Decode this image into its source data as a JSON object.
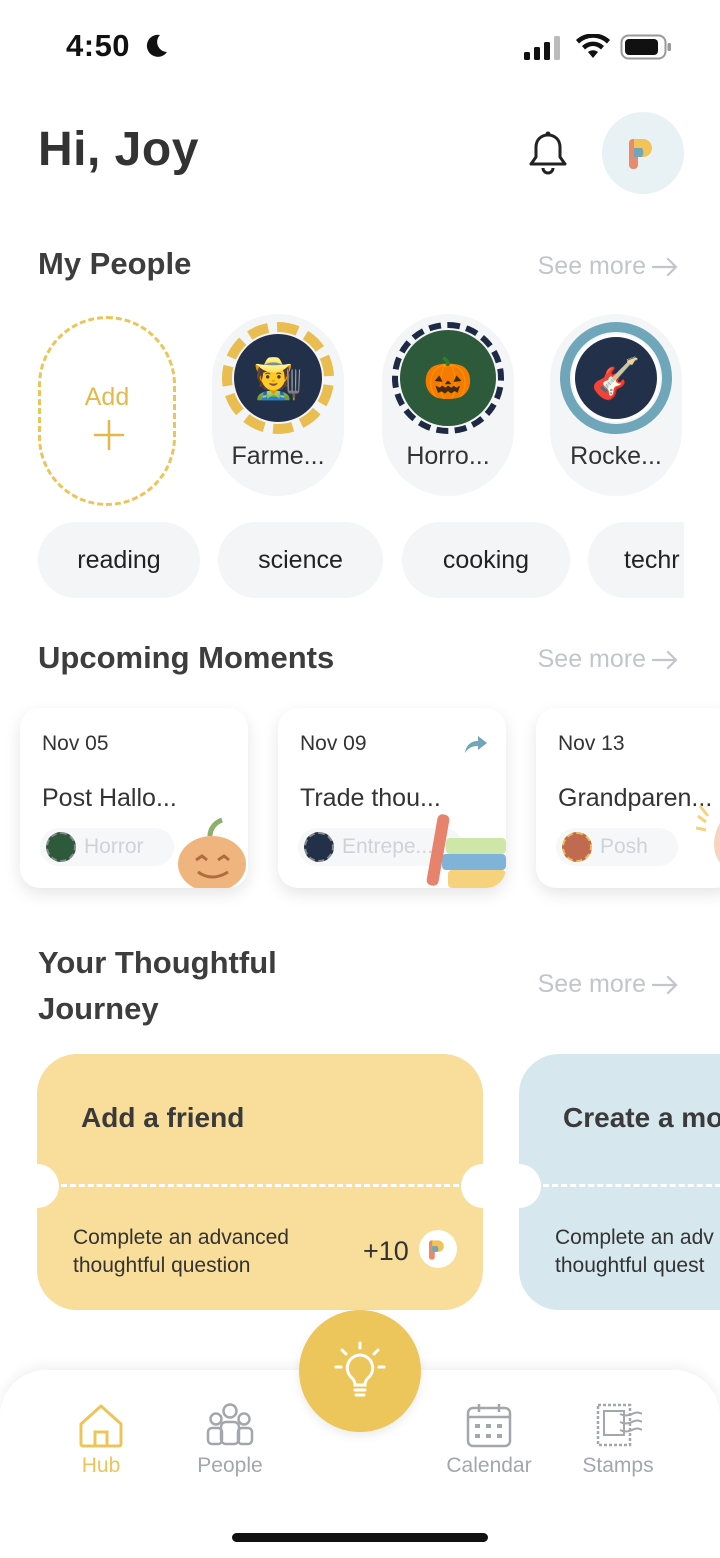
{
  "status_bar": {
    "time": "4:50"
  },
  "header": {
    "greeting": "Hi, Joy"
  },
  "my_people": {
    "title": "My People",
    "see_more": "See more",
    "add_label": "Add",
    "people": [
      {
        "name": "Farme...",
        "emoji": "🧑‍🌾",
        "ring_color": "#e9bd4f"
      },
      {
        "name": "Horro...",
        "emoji": "🎃",
        "ring_color": "#1e2a44"
      },
      {
        "name": "Rocke...",
        "emoji": "🎸",
        "ring_color": "#6fa6ba"
      }
    ],
    "interests": [
      "reading",
      "science",
      "cooking",
      "techr"
    ]
  },
  "upcoming_moments": {
    "title": "Upcoming Moments",
    "see_more": "See more",
    "cards": [
      {
        "date": "Nov 05",
        "title": "Post Hallo...",
        "tag": "Horror"
      },
      {
        "date": "Nov 09",
        "title": "Trade thou...",
        "tag": "Entrepe..."
      },
      {
        "date": "Nov 13",
        "title": "Grandparen...",
        "tag": "Posh"
      }
    ]
  },
  "journey": {
    "title_line1": "Your Thoughtful",
    "title_line2": "Journey",
    "see_more": "See more",
    "tickets": [
      {
        "title": "Add a friend",
        "desc_line1": "Complete an advanced",
        "desc_line2": "thoughtful question",
        "points": "+10",
        "color": "#f8dd9b"
      },
      {
        "title": "Create a mo",
        "desc_line1": "Complete an adv",
        "desc_line2": "thoughtful quest",
        "points": "",
        "color": "#d6e8ee"
      }
    ]
  },
  "tabbar": {
    "tabs": [
      {
        "label": "Hub",
        "icon": "home-icon",
        "active": true
      },
      {
        "label": "People",
        "icon": "people-icon",
        "active": false
      },
      {
        "label": "Calendar",
        "icon": "calendar-icon",
        "active": false
      },
      {
        "label": "Stamps",
        "icon": "stamp-icon",
        "active": false
      }
    ],
    "center_icon": "lightbulb-icon"
  },
  "colors": {
    "accent": "#edc45a",
    "muted": "#c2c6cc",
    "chip_bg": "#f4f5f6"
  }
}
